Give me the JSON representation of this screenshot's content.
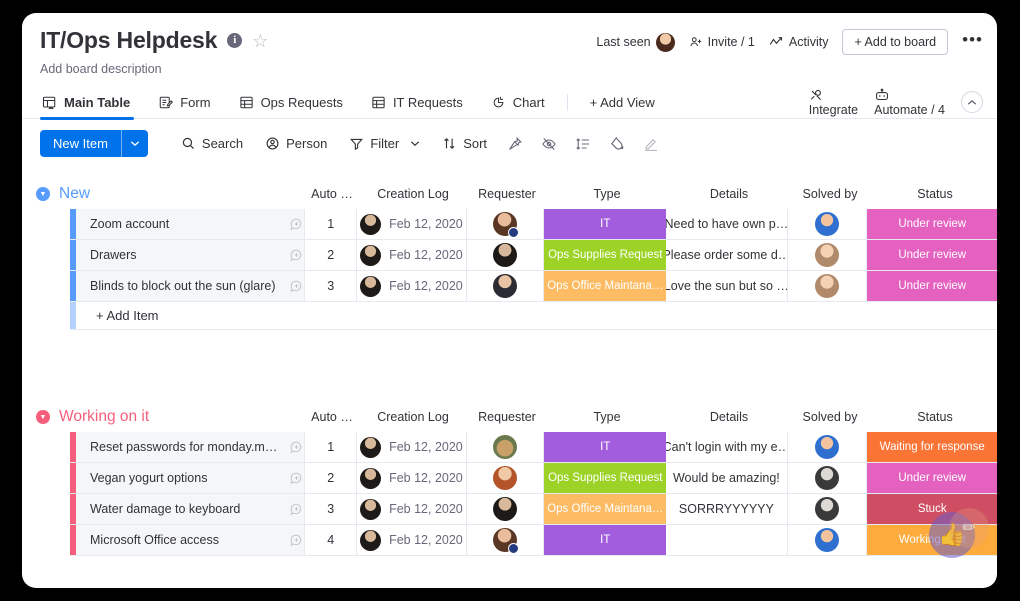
{
  "board": {
    "title": "IT/Ops Helpdesk",
    "description": "Add board description",
    "info_icon": "info-icon",
    "star_icon": "star-icon"
  },
  "header_actions": {
    "last_seen_label": "Last seen",
    "invite_label": "Invite / 1",
    "activity_label": "Activity",
    "add_to_board_label": "+ Add to board",
    "more_label": "•••"
  },
  "tabs": [
    {
      "label": "Main Table",
      "icon": "table-home-icon",
      "active": true
    },
    {
      "label": "Form",
      "icon": "form-icon",
      "active": false
    },
    {
      "label": "Ops Requests",
      "icon": "table-icon",
      "active": false
    },
    {
      "label": "IT Requests",
      "icon": "table-icon",
      "active": false
    },
    {
      "label": "Chart",
      "icon": "pie-chart-icon",
      "active": false
    },
    {
      "label": "+ Add View",
      "icon": "",
      "active": false
    }
  ],
  "tabs_right": {
    "integrate_label": "Integrate",
    "automate_label": "Automate / 4",
    "collapse_icon": "chevron-up-icon"
  },
  "toolbar": {
    "new_item_label": "New Item",
    "new_item_caret": "▾",
    "search_label": "Search",
    "person_label": "Person",
    "filter_label": "Filter",
    "filter_caret": "▾",
    "sort_label": "Sort",
    "icons": [
      "pin-icon",
      "hide-icon",
      "row-height-icon",
      "color-icon",
      "highlight-icon"
    ]
  },
  "columns": [
    {
      "key": "name",
      "label": ""
    },
    {
      "key": "autonumber",
      "label": "Auto …"
    },
    {
      "key": "creation",
      "label": "Creation Log"
    },
    {
      "key": "requester",
      "label": "Requester"
    },
    {
      "key": "type",
      "label": "Type"
    },
    {
      "key": "details",
      "label": "Details"
    },
    {
      "key": "solvedby",
      "label": "Solved by"
    },
    {
      "key": "status",
      "label": "Status"
    }
  ],
  "colors": {
    "new_group": "#579bfc",
    "working_group": "#e2445c_pink",
    "working_group_hex": "#f65f7c",
    "type_it": "#a25ddc",
    "type_ops_supplies": "#9cd326",
    "type_ops_office": "#fdbc64",
    "status_under_review": "#e461bf",
    "status_waiting": "#fa7436",
    "status_stuck": "#d04e63",
    "status_working": "#fdab3d",
    "accent_blue": "#0073ea",
    "row_bg": "#f5f6f8",
    "border": "#e6e9ef"
  },
  "groups": [
    {
      "name": "New",
      "color": "#579bfc",
      "caret_icon": "chevron-down-circle-icon",
      "add_item_label": "+ Add Item",
      "rows": [
        {
          "name": "Zoom account",
          "autonumber": "1",
          "creation": "Feb 12, 2020",
          "creation_avatar": "avatar-dark",
          "requester_avatar": "avatar-woman-badge",
          "requester_badge": true,
          "type": "IT",
          "type_color": "#a25ddc",
          "details": "Need to have own p…",
          "solved_avatar": "avatar-hero",
          "status": "Under review",
          "status_color": "#e461bf"
        },
        {
          "name": "Drawers",
          "autonumber": "2",
          "creation": "Feb 12, 2020",
          "creation_avatar": "avatar-dark",
          "requester_avatar": "avatar-dark",
          "requester_badge": false,
          "type": "Ops Supplies Request",
          "type_color": "#9cd326",
          "details": "Please order some d…",
          "solved_avatar": "avatar-woman2",
          "status": "Under review",
          "status_color": "#e461bf"
        },
        {
          "name": "Blinds to block out the sun (glare)",
          "autonumber": "3",
          "creation": "Feb 12, 2020",
          "creation_avatar": "avatar-dark",
          "requester_avatar": "avatar-man",
          "requester_badge": false,
          "type": "Ops Office Maintana…",
          "type_color": "#fdbc64",
          "details": "Love the sun but so …",
          "solved_avatar": "avatar-woman2",
          "status": "Under review",
          "status_color": "#e461bf"
        }
      ]
    },
    {
      "name": "Working on it",
      "color": "#f65f7c",
      "caret_icon": "chevron-down-circle-icon",
      "add_item_label": "+ Add Item",
      "rows": [
        {
          "name": "Reset passwords for monday.mond…",
          "autonumber": "1",
          "creation": "Feb 12, 2020",
          "creation_avatar": "avatar-dark",
          "requester_avatar": "avatar-dog",
          "requester_badge": false,
          "type": "IT",
          "type_color": "#a25ddc",
          "details": "Can't login with my e…",
          "solved_avatar": "avatar-hero",
          "status": "Waiting for response",
          "status_color": "#fa7436"
        },
        {
          "name": "Vegan yogurt options",
          "autonumber": "2",
          "creation": "Feb 12, 2020",
          "creation_avatar": "avatar-dark",
          "requester_avatar": "avatar-woman3",
          "requester_badge": false,
          "type": "Ops Supplies Request",
          "type_color": "#9cd326",
          "details": "Would be amazing!",
          "solved_avatar": "avatar-grey",
          "status": "Under review",
          "status_color": "#e461bf"
        },
        {
          "name": "Water damage to keyboard",
          "autonumber": "3",
          "creation": "Feb 12, 2020",
          "creation_avatar": "avatar-dark",
          "requester_avatar": "avatar-dark",
          "requester_badge": false,
          "type": "Ops Office Maintana…",
          "type_color": "#fdbc64",
          "details": "SORRRYYYYYY",
          "solved_avatar": "avatar-grey",
          "status": "Stuck",
          "status_color": "#d04e63"
        },
        {
          "name": "Microsoft Office access",
          "autonumber": "4",
          "creation": "Feb 12, 2020",
          "creation_avatar": "avatar-dark",
          "requester_avatar": "avatar-woman-badge",
          "requester_badge": true,
          "type": "IT",
          "type_color": "#a25ddc",
          "details": "",
          "solved_avatar": "avatar-hero",
          "status": "Working on it",
          "status_color": "#fdab3d"
        }
      ]
    }
  ],
  "fab": {
    "icon": "thumbs-up-icon",
    "glyph": "👍",
    "secondary_icon": "confetti-icon",
    "secondary_glyph": "✏"
  }
}
